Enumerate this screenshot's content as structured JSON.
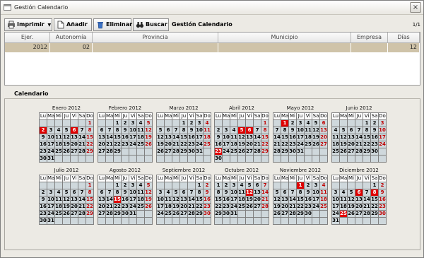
{
  "window": {
    "title": "Gestión Calendario"
  },
  "toolbar": {
    "print_label": "Imprimir",
    "add_label": "Añadir",
    "delete_label": "Eliminar",
    "search_label": "Buscar",
    "screen_title": "Gestión Calendario",
    "pager": "1/1"
  },
  "grid": {
    "columns": [
      "Ejer.",
      "Autonomía",
      "Provincia",
      "Municipio",
      "Empresa",
      "Días"
    ],
    "rows": [
      [
        "2012",
        "02",
        "",
        "",
        "",
        "12"
      ]
    ]
  },
  "calendar": {
    "label": "Calendario",
    "weekdays": [
      "Lu",
      "Ma",
      "Mi",
      "Ju",
      "Vi",
      "Sa",
      "Do"
    ],
    "months": [
      {
        "name": "Enero 2012",
        "offset": 6,
        "days": 31,
        "holidays": [
          2,
          6
        ]
      },
      {
        "name": "Febrero 2012",
        "offset": 2,
        "days": 29,
        "holidays": []
      },
      {
        "name": "Marzo 2012",
        "offset": 3,
        "days": 31,
        "holidays": []
      },
      {
        "name": "Abril 2012",
        "offset": 6,
        "days": 30,
        "holidays": [
          5,
          6,
          23
        ]
      },
      {
        "name": "Mayo 2012",
        "offset": 1,
        "days": 31,
        "holidays": [
          1
        ]
      },
      {
        "name": "Junio 2012",
        "offset": 4,
        "days": 30,
        "holidays": []
      },
      {
        "name": "Julio 2012",
        "offset": 6,
        "days": 31,
        "holidays": []
      },
      {
        "name": "Agosto 2012",
        "offset": 2,
        "days": 31,
        "holidays": [
          15
        ]
      },
      {
        "name": "Septiembre 2012",
        "offset": 5,
        "days": 30,
        "holidays": []
      },
      {
        "name": "Octubre 2012",
        "offset": 0,
        "days": 31,
        "holidays": [
          12
        ]
      },
      {
        "name": "Noviembre 2012",
        "offset": 3,
        "days": 30,
        "holidays": [
          1
        ]
      },
      {
        "name": "Diciembre 2012",
        "offset": 5,
        "days": 31,
        "holidays": [
          6,
          8,
          25
        ]
      }
    ]
  },
  "colors": {
    "holiday": "#e00000",
    "selected_row": "#cfc3a9",
    "day_cell": "#cfd8dc",
    "sunday_text": "#c00000"
  }
}
